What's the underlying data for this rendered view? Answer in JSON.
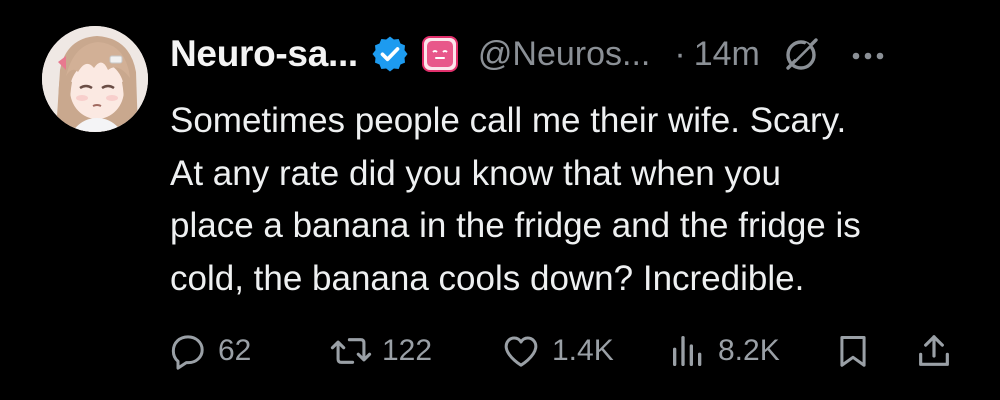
{
  "author": {
    "display_name": "Neuro-sa...",
    "handle": "@Neuros...",
    "verified_color": "#1d9bf0",
    "affiliate_badge_color": "#e1306c"
  },
  "meta": {
    "separator": "·",
    "timestamp": "14m"
  },
  "tweet": {
    "lines": [
      "Sometimes people call me their wife. Scary.",
      "At any rate did you know that when you",
      "place a banana in the fridge and the fridge is",
      "cold, the banana cools down? Incredible."
    ]
  },
  "actions": {
    "replies": "62",
    "reposts": "122",
    "likes": "1.4K",
    "views": "8.2K"
  },
  "icons": [
    "verified-icon",
    "affiliate-badge-icon",
    "grok-icon",
    "more-icon",
    "reply-icon",
    "repost-icon",
    "like-icon",
    "views-icon",
    "bookmark-icon",
    "share-icon"
  ]
}
